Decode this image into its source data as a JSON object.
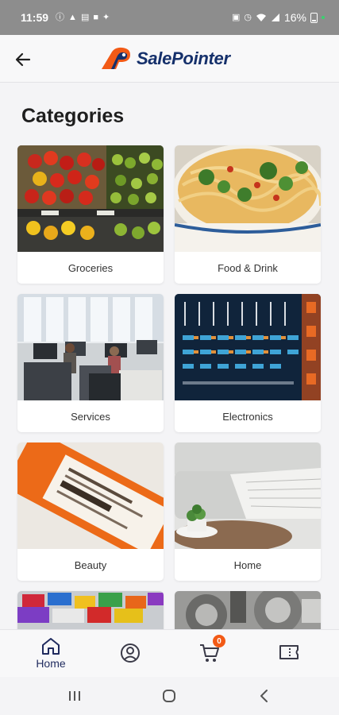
{
  "status_bar": {
    "time": "11:59",
    "left_icons": [
      "sim-icon",
      "notification-icon",
      "message-icon",
      "video-icon",
      "activity-icon"
    ],
    "battery": "16%",
    "right_icons": [
      "lock-icon",
      "alarm-icon",
      "wifi-icon",
      "signal-icon",
      "battery-icon"
    ]
  },
  "header": {
    "logo_text": "SalePointer",
    "brand_color": "#15306b",
    "accent_color": "#f25a16"
  },
  "page": {
    "title": "Categories"
  },
  "categories": [
    {
      "label": "Groceries"
    },
    {
      "label": "Food & Drink"
    },
    {
      "label": "Services"
    },
    {
      "label": "Electronics"
    },
    {
      "label": "Beauty"
    },
    {
      "label": "Home"
    },
    {
      "label": ""
    },
    {
      "label": ""
    }
  ],
  "bottom_nav": {
    "items": [
      {
        "label": "Home",
        "icon": "home-icon",
        "active": true
      },
      {
        "label": "",
        "icon": "profile-icon"
      },
      {
        "label": "",
        "icon": "cart-icon",
        "badge": "0"
      },
      {
        "label": "",
        "icon": "ticket-icon"
      }
    ]
  },
  "system_nav": [
    "recents-icon",
    "home-circle-icon",
    "back-chevron-icon"
  ]
}
